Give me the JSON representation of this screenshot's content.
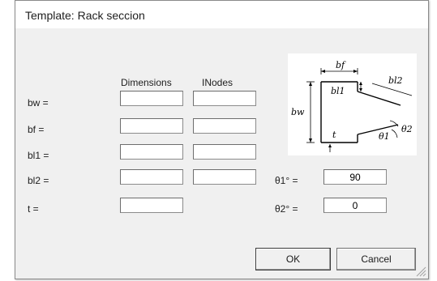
{
  "window": {
    "title": "Template: Rack seccion"
  },
  "columns": {
    "dimensions": "Dimensions",
    "inodes": "INodes"
  },
  "rows": [
    {
      "label": "bw =",
      "dimension": "",
      "inodes": ""
    },
    {
      "label": "bf =",
      "dimension": "",
      "inodes": ""
    },
    {
      "label": "bl1 =",
      "dimension": "",
      "inodes": ""
    },
    {
      "label": "bl2 =",
      "dimension": "",
      "inodes": ""
    },
    {
      "label": "t =",
      "dimension": ""
    }
  ],
  "angles": [
    {
      "label": "θ1° =",
      "value": "90"
    },
    {
      "label": "θ2° =",
      "value": "0"
    }
  ],
  "diagram": {
    "bf": "bf",
    "bl2": "bl2",
    "bl1": "bl1",
    "bw": "bw",
    "t": "t",
    "theta1": "θ1",
    "theta2": "θ2"
  },
  "buttons": {
    "ok": "OK",
    "cancel": "Cancel"
  }
}
